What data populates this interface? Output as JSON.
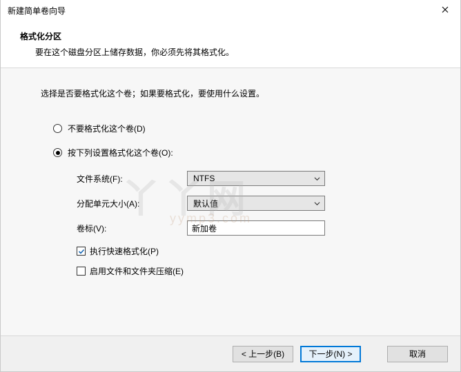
{
  "window": {
    "title": "新建简单卷向导"
  },
  "header": {
    "title": "格式化分区",
    "description": "要在这个磁盘分区上储存数据，你必须先将其格式化。"
  },
  "content": {
    "instruction": "选择是否要格式化这个卷；如果要格式化，要使用什么设置。",
    "radio_no_format": "不要格式化这个卷(D)",
    "radio_format": "按下列设置格式化这个卷(O):",
    "fs_label": "文件系统(F):",
    "fs_value": "NTFS",
    "alloc_label": "分配单元大小(A):",
    "alloc_value": "默认值",
    "vol_label": "卷标(V):",
    "vol_value": "新加卷",
    "quick_format": "执行快速格式化(P)",
    "compression": "启用文件和文件夹压缩(E)"
  },
  "footer": {
    "back": "< 上一步(B)",
    "next": "下一步(N) >",
    "cancel": "取消"
  },
  "watermark": {
    "main": "丫丫网",
    "sub": "yymp3.com"
  }
}
